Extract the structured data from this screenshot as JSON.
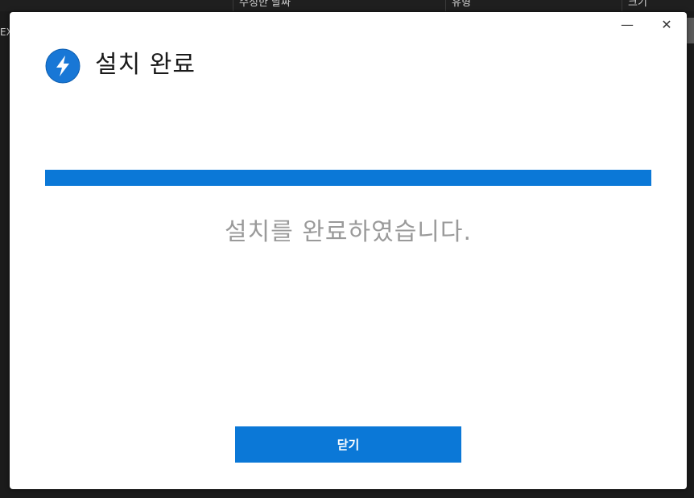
{
  "background": {
    "columns": [
      "수정한 날짜",
      "유형",
      "크기"
    ],
    "left_fragment": "EX"
  },
  "window_controls": {
    "minimize": "—",
    "close": "✕"
  },
  "dialog": {
    "title": "설치 완료",
    "progress_value": 1.0,
    "message": "설치를 완료하였습니다.",
    "close_button_label": "닫기",
    "logo_icon": "lightning-bolt-icon",
    "accent_color": "#0b78d7"
  }
}
